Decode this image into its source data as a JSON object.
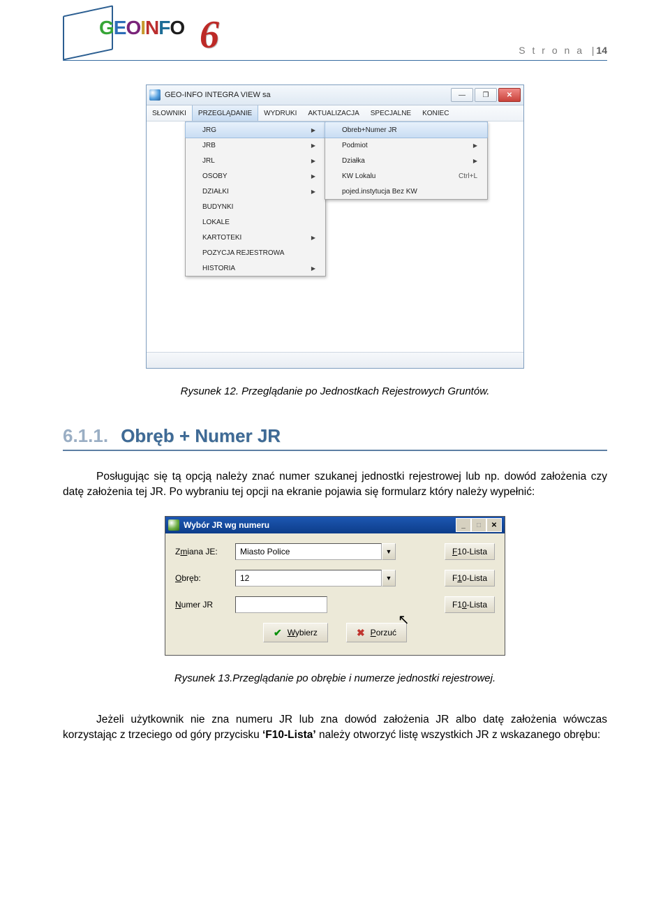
{
  "header": {
    "logo_parts": [
      "G",
      "E",
      "O",
      "I",
      "N",
      "F",
      "O"
    ],
    "logo_six": "6",
    "page_label_prefix": "S t r o n a",
    "page_sep": "|",
    "page_number": "14"
  },
  "screenshot1": {
    "title": "GEO-INFO INTEGRA VIEW  sa",
    "window_buttons": {
      "min": "—",
      "max": "❐",
      "close": "✕"
    },
    "menubar": [
      "SŁOWNIKI",
      "PRZEGLĄDANIE",
      "WYDRUKI",
      "AKTUALIZACJA",
      "SPECJALNE",
      "KONIEC"
    ],
    "menubar_active_index": 1,
    "menu_a": [
      {
        "label": "JRG",
        "arrow": true,
        "selected": true
      },
      {
        "label": "JRB",
        "arrow": true
      },
      {
        "label": "JRL",
        "arrow": true
      },
      {
        "label": "OSOBY",
        "arrow": true
      },
      {
        "label": "DZIAŁKI",
        "arrow": true
      },
      {
        "label": "BUDYNKI"
      },
      {
        "label": "LOKALE"
      },
      {
        "label": "KARTOTEKI",
        "arrow": true
      },
      {
        "label": "POZYCJA REJESTROWA"
      },
      {
        "label": "HISTORIA",
        "arrow": true
      }
    ],
    "menu_b": [
      {
        "label": "Obreb+Numer JR",
        "selected": true
      },
      {
        "label": "Podmiot",
        "arrow": true
      },
      {
        "label": "Działka",
        "arrow": true
      },
      {
        "label": "KW Lokalu",
        "shortcut": "Ctrl+L"
      },
      {
        "label": "pojed.instytucja Bez KW"
      }
    ]
  },
  "caption1": "Rysunek 12. Przeglądanie po Jednostkach Rejestrowych Gruntów.",
  "section": {
    "num": "6.1.1.",
    "title": "Obręb + Numer JR"
  },
  "para1_a": "Posługując się tą opcją należy znać numer szukanej jednostki rejestrowej lub np. dowód założenia czy datę założenia tej JR. Po wybraniu tej opcji na ekranie pojawia się formularz który należy wypełnić:",
  "screenshot2": {
    "title": "Wybór JR wg numeru",
    "window_buttons": {
      "min": "_",
      "max": "□",
      "close": "✕"
    },
    "rows": {
      "je": {
        "label_pre": "Z",
        "label_u": "m",
        "label_post": "iana JE:",
        "value": "Miasto Police",
        "btn_u": "F",
        "btn_rest": "10-Lista"
      },
      "obreb": {
        "label_u": "O",
        "label_post": "bręb:",
        "value": "12",
        "btn_pre": "F",
        "btn_u": "1",
        "btn_rest": "0-Lista"
      },
      "numer": {
        "label_u": "N",
        "label_post": "umer JR",
        "value": "",
        "btn_pre": "F1",
        "btn_u": "0",
        "btn_rest": "-Lista"
      }
    },
    "btn_wybierz": {
      "icon": "✔",
      "u": "W",
      "rest": "ybierz"
    },
    "btn_porzuc": {
      "icon": "✖",
      "u": "P",
      "rest": "orzuć"
    }
  },
  "caption2": "Rysunek 13.Przeglądanie po obrębie i numerze jednostki rejestrowej.",
  "para2_a": "Jeżeli użytkownik nie zna numeru JR lub zna dowód założenia JR albo datę założenia wówczas korzystając z trzeciego od góry przycisku ",
  "para2_b": "‘F10-Lista’",
  "para2_c": " należy otworzyć listę wszystkich JR z wskazanego obrębu:"
}
